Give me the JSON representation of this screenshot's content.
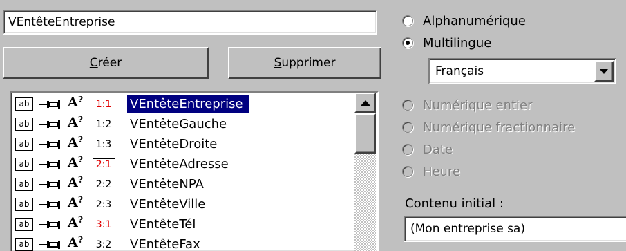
{
  "name_field": {
    "value": "VEntêteEntreprise"
  },
  "buttons": {
    "create": "Créer",
    "delete": "Supprimer"
  },
  "list": {
    "selected_index": 0,
    "rows": [
      {
        "icon_text": "ab",
        "ratio": "1:1",
        "red": true,
        "bar": false,
        "label": "VEntêteEntreprise"
      },
      {
        "icon_text": "ab",
        "ratio": "1:2",
        "red": false,
        "bar": false,
        "label": "VEntêteGauche"
      },
      {
        "icon_text": "ab",
        "ratio": "1:3",
        "red": false,
        "bar": false,
        "label": "VEntêteDroite"
      },
      {
        "icon_text": "ab",
        "ratio": "2:1",
        "red": true,
        "bar": true,
        "label": "VEntêteAdresse"
      },
      {
        "icon_text": "ab",
        "ratio": "2:2",
        "red": false,
        "bar": false,
        "label": "VEntêteNPA"
      },
      {
        "icon_text": "ab",
        "ratio": "2:3",
        "red": false,
        "bar": false,
        "label": "VEntêteVille"
      },
      {
        "icon_text": "ab",
        "ratio": "3:1",
        "red": true,
        "bar": true,
        "label": "VEntêteTél"
      },
      {
        "icon_text": "ab",
        "ratio": "3:2",
        "red": false,
        "bar": false,
        "label": "VEntêteFax"
      }
    ]
  },
  "types": {
    "alphanumeric": "Alphanumérique",
    "multilingual": "Multilingue",
    "integer": "Numérique entier",
    "fractional": "Numérique fractionnaire",
    "date": "Date",
    "time": "Heure"
  },
  "language": {
    "value": "Français"
  },
  "initial": {
    "label": "Contenu initial :",
    "value": "(Mon entreprise sa)"
  },
  "colors": {
    "selection": "#000080",
    "face": "#c0c0c0",
    "red_ratio": "#e00000"
  }
}
